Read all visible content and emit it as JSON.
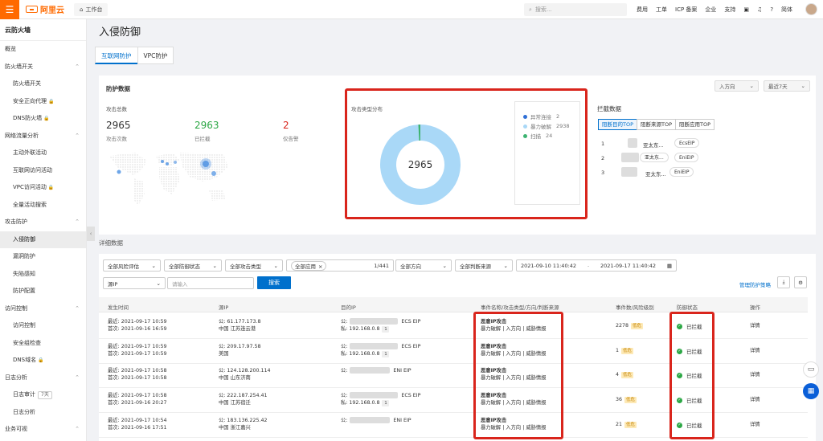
{
  "topbar": {
    "logo": "阿里云",
    "workbench": "工作台",
    "search_placeholder": "搜索...",
    "nav": [
      "费用",
      "工单",
      "ICP 备案",
      "企业",
      "支持"
    ],
    "lang": "简体"
  },
  "sidebar": {
    "title": "云防火墙",
    "items": [
      {
        "label": "概览",
        "type": "top"
      },
      {
        "label": "防火墙开关",
        "type": "group"
      },
      {
        "label": "防火墙开关",
        "type": "item"
      },
      {
        "label": "安全正向代理",
        "type": "item",
        "lock": true
      },
      {
        "label": "DNS防火墙",
        "type": "item",
        "lock": true
      },
      {
        "label": "网络流量分析",
        "type": "group"
      },
      {
        "label": "主动外联活动",
        "type": "item"
      },
      {
        "label": "互联网访问活动",
        "type": "item"
      },
      {
        "label": "VPC访问活动",
        "type": "item",
        "lock": true
      },
      {
        "label": "全量活动搜索",
        "type": "item"
      },
      {
        "label": "攻击防护",
        "type": "group"
      },
      {
        "label": "入侵防御",
        "type": "item",
        "active": true
      },
      {
        "label": "漏洞防护",
        "type": "item"
      },
      {
        "label": "失陷感知",
        "type": "item"
      },
      {
        "label": "防护配置",
        "type": "item"
      },
      {
        "label": "访问控制",
        "type": "group"
      },
      {
        "label": "访问控制",
        "type": "item"
      },
      {
        "label": "安全组检查",
        "type": "item"
      },
      {
        "label": "DNS域名",
        "type": "item",
        "lock": true
      },
      {
        "label": "日志分析",
        "type": "group"
      },
      {
        "label": "日志审计",
        "type": "item",
        "badge": "7天"
      },
      {
        "label": "日志分析",
        "type": "item"
      },
      {
        "label": "业务可视",
        "type": "group"
      }
    ]
  },
  "page": {
    "title": "入侵防御",
    "tabs": [
      "互联网防护",
      "VPC防护"
    ]
  },
  "protection": {
    "title": "防护数据",
    "direction": "入方向",
    "range": "最近7天",
    "attack_total_label": "攻击总数",
    "stats": [
      {
        "value": "2965",
        "label": "攻击次数",
        "color": "#333333"
      },
      {
        "value": "2963",
        "label": "已拦截",
        "color": "#2ca745"
      },
      {
        "value": "2",
        "label": "仅告警",
        "color": "#d9251c"
      }
    ],
    "dist_title": "攻击类型分布",
    "center_value": "2965"
  },
  "chart_data": {
    "type": "pie",
    "title": "攻击类型分布",
    "total": "2965",
    "categories": [
      "异常连接",
      "暴力破解",
      "扫描"
    ],
    "values": [
      2,
      2938,
      24
    ],
    "colors": [
      "#2f6fd6",
      "#a9d8f7",
      "#3cb371"
    ]
  },
  "block": {
    "title": "拦截数据",
    "tabs": [
      "阻断目的TOP",
      "阻断来源TOP",
      "阻断应用TOP"
    ],
    "rows": [
      {
        "rank": "1",
        "region": "亚太东...",
        "tag": "EcsEIP"
      },
      {
        "rank": "2",
        "region": "亚太东...",
        "tag": "EniEIP"
      },
      {
        "rank": "3",
        "region": "亚太东...",
        "tag": "EniEIP"
      }
    ]
  },
  "detail": {
    "title": "详细数据",
    "filters": {
      "risk": "全部风险评估",
      "status": "全部防御状态",
      "attack_type": "全部攻击类型",
      "app_tag": "全部应用",
      "count": "1/441",
      "direction": "全部方向",
      "source": "全部判断来源",
      "start": "2021-09-10 11:40:42",
      "end": "2021-09-17 11:40:42",
      "field": "源IP",
      "input_placeholder": "请输入",
      "search": "搜索",
      "manage": "管理防护策略"
    },
    "columns": [
      "发生时间",
      "源IP",
      "目的IP",
      "事件名称/攻击类型/方向/判断来源",
      "事件数/风险级别",
      "防御状态",
      "操作"
    ],
    "rows": [
      {
        "latest": "最近: 2021-09-17 10:59",
        "first": "首次: 2021-09-16 16:59",
        "src_ip": "公: 61.177.173.8",
        "src_loc": "中国 江苏连云港",
        "dst_pub": "公:",
        "dst_type": "ECS EIP",
        "dst_priv": "私: 192.168.0.8",
        "dst_count": "1",
        "event": "恶意IP攻击",
        "meta": "暴力破解 | 入方向 | 威胁情报",
        "count": "2278",
        "level": "低危",
        "status": "已拦截",
        "op": "详情"
      },
      {
        "latest": "最近: 2021-09-17 10:59",
        "first": "首次: 2021-09-17 10:59",
        "src_ip": "公: 209.17.97.58",
        "src_loc": "美国",
        "dst_pub": "公:",
        "dst_type": "ECS EIP",
        "dst_priv": "私: 192.168.0.8",
        "dst_count": "1",
        "event": "恶意IP攻击",
        "meta": "暴力破解 | 入方向 | 威胁情报",
        "count": "1",
        "level": "低危",
        "status": "已拦截",
        "op": "详情"
      },
      {
        "latest": "最近: 2021-09-17 10:58",
        "first": "首次: 2021-09-17 10:58",
        "src_ip": "公: 124.128.200.114",
        "src_loc": "中国 山东济南",
        "dst_pub": "公:",
        "dst_type": "ENI EIP",
        "dst_priv": "",
        "dst_count": "",
        "event": "恶意IP攻击",
        "meta": "暴力破解 | 入方向 | 威胁情报",
        "count": "4",
        "level": "低危",
        "status": "已拦截",
        "op": "详情"
      },
      {
        "latest": "最近: 2021-09-17 10:58",
        "first": "首次: 2021-09-16 20:27",
        "src_ip": "公: 222.187.254.41",
        "src_loc": "中国 江苏宿迁",
        "dst_pub": "公:",
        "dst_type": "ECS EIP",
        "dst_priv": "私: 192.168.0.8",
        "dst_count": "1",
        "event": "恶意IP攻击",
        "meta": "暴力破解 | 入方向 | 威胁情报",
        "count": "36",
        "level": "低危",
        "status": "已拦截",
        "op": "详情"
      },
      {
        "latest": "最近: 2021-09-17 10:54",
        "first": "首次: 2021-09-16 17:51",
        "src_ip": "公: 183.136.225.42",
        "src_loc": "中国 浙江嘉兴",
        "dst_pub": "公:",
        "dst_type": "ENI EIP",
        "dst_priv": "",
        "dst_count": "",
        "event": "恶意IP攻击",
        "meta": "暴力破解 | 入方向 | 威胁情报",
        "count": "21",
        "level": "低危",
        "status": "已拦截",
        "op": "详情"
      }
    ]
  }
}
